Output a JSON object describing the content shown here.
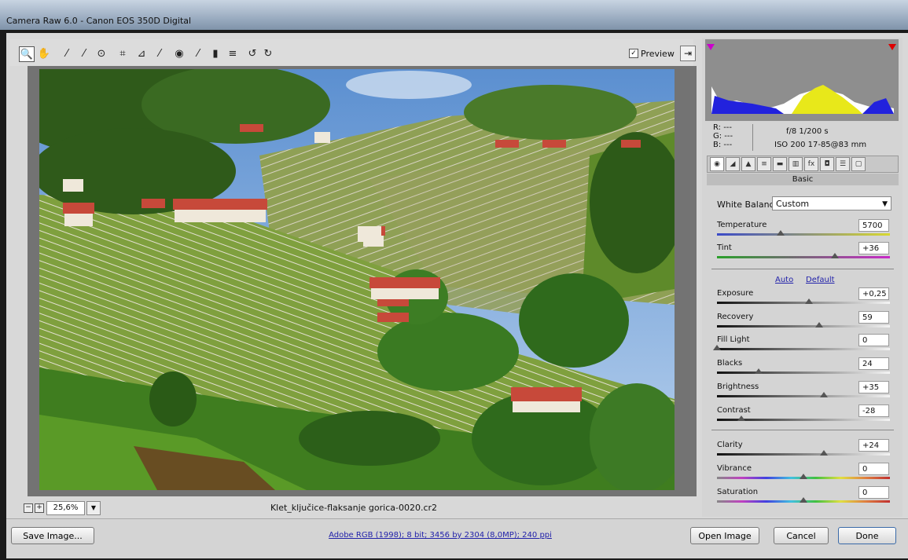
{
  "window": {
    "title": "Camera Raw 6.0  -  Canon EOS 350D Digital"
  },
  "toolbar": {
    "tools": [
      {
        "name": "zoom-tool",
        "glyph": "🔍",
        "active": true
      },
      {
        "name": "hand-tool",
        "glyph": "✋"
      },
      {
        "name": "white-balance-tool",
        "glyph": "⁄"
      },
      {
        "name": "color-sampler-tool",
        "glyph": "⁄"
      },
      {
        "name": "targeted-adjustment-tool",
        "glyph": "⊙"
      },
      {
        "name": "crop-tool",
        "glyph": "⌗"
      },
      {
        "name": "straighten-tool",
        "glyph": "⊿"
      },
      {
        "name": "spot-removal-tool",
        "glyph": "⁄"
      },
      {
        "name": "red-eye-tool",
        "glyph": "◉"
      },
      {
        "name": "adjustment-brush-tool",
        "glyph": "⁄"
      },
      {
        "name": "graduated-filter-tool",
        "glyph": "▮"
      },
      {
        "name": "preferences-tool",
        "glyph": "≡"
      },
      {
        "name": "rotate-ccw-tool",
        "glyph": "↺"
      },
      {
        "name": "rotate-cw-tool",
        "glyph": "↻"
      }
    ],
    "preview_label": "Preview",
    "preview_checked": "✓"
  },
  "status": {
    "zoom": "25,6%",
    "filename": "Klet_ključice-flaksanje gorica-0020.cr2",
    "minus": "−",
    "plus": "+"
  },
  "workflow": "Adobe RGB (1998); 8 bit; 3456 by 2304 (8,0MP); 240 ppi",
  "buttons": {
    "save": "Save Image...",
    "open": "Open Image",
    "cancel": "Cancel",
    "done": "Done"
  },
  "info": {
    "r": "R:  ---",
    "g": "G:  ---",
    "b": "B:  ---",
    "aperture_shutter": "f/8   1/200 s",
    "iso_lens": "ISO 200   17-85@83 mm"
  },
  "panel": {
    "title": "Basic",
    "tabs": [
      "◉",
      "◢",
      "▲",
      "≡",
      "▬",
      "▥",
      "fx",
      "◘",
      "☰",
      "▢"
    ],
    "white_balance_label": "White Balance:",
    "white_balance_value": "Custom",
    "auto": "Auto",
    "default": "Default",
    "sliders": [
      {
        "label": "Temperature",
        "value": "5700",
        "level": 0.37,
        "track": "temp"
      },
      {
        "label": "Tint",
        "value": "+36",
        "level": 0.68,
        "track": "tint"
      },
      {
        "label": "Exposure",
        "value": "+0,25",
        "level": 0.53,
        "track": "gray"
      },
      {
        "label": "Recovery",
        "value": "59",
        "level": 0.59,
        "track": "gray"
      },
      {
        "label": "Fill Light",
        "value": "0",
        "level": 0.0,
        "track": "gray"
      },
      {
        "label": "Blacks",
        "value": "24",
        "level": 0.24,
        "track": "gray"
      },
      {
        "label": "Brightness",
        "value": "+35",
        "level": 0.62,
        "track": "gray"
      },
      {
        "label": "Contrast",
        "value": "-28",
        "level": 0.14,
        "track": "gray"
      },
      {
        "label": "Clarity",
        "value": "+24",
        "level": 0.62,
        "track": "gray"
      },
      {
        "label": "Vibrance",
        "value": "0",
        "level": 0.5,
        "track": "rainbow"
      },
      {
        "label": "Saturation",
        "value": "0",
        "level": 0.5,
        "track": "rainbow"
      }
    ]
  },
  "colors": {
    "accent_link": "#2222aa",
    "clip_warning_shadow": "#cc00cc",
    "clip_warning_highlight": "#dd0000"
  }
}
